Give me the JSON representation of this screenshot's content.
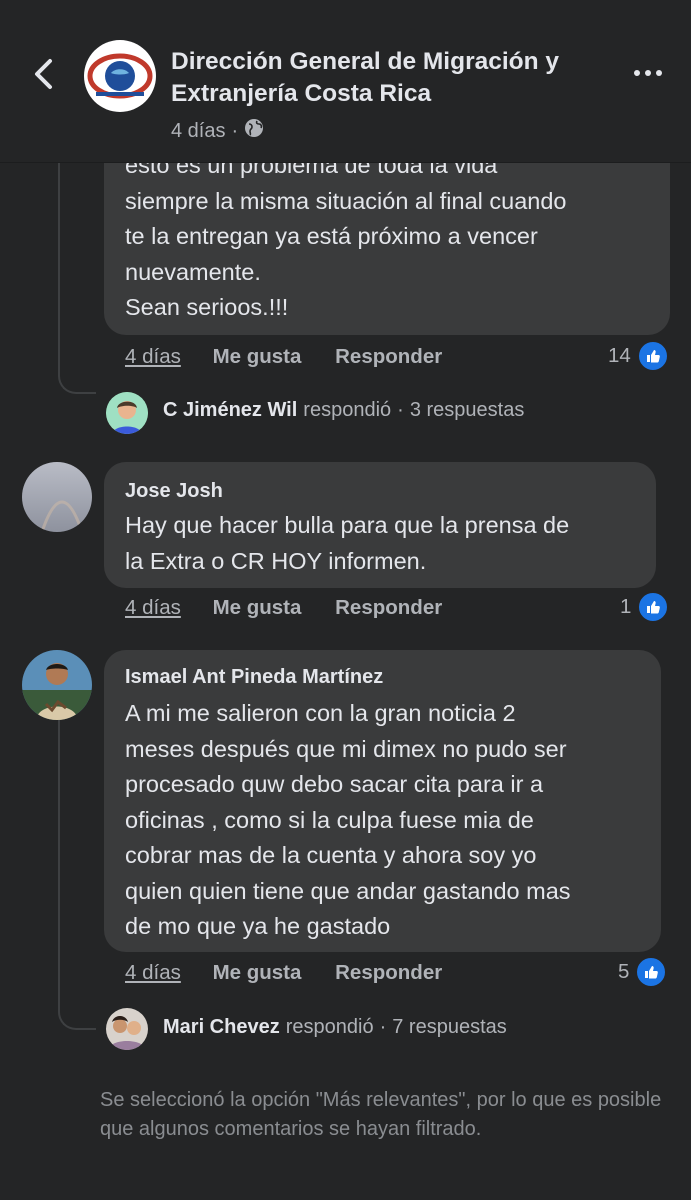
{
  "header": {
    "page_name": "Dirección General de Migración y Extranjería Costa Rica",
    "time": "4 días",
    "separator": "·",
    "audience_icon": "globe-icon",
    "back_icon": "chevron-left-icon",
    "more_icon": "more-horizontal-icon"
  },
  "comments": [
    {
      "text": "esto es un problema de toda la vida\nsiempre la misma situación al final cuando\nte la entregan ya está próximo a vencer\nnuevamente.\nSean serioos.!!!",
      "time": "4 días",
      "like_label": "Me gusta",
      "reply_label": "Responder",
      "likes": "14"
    },
    {
      "author": "Jose Josh",
      "text": "Hay que hacer bulla para que la prensa de\nla Extra o CR HOY informen.",
      "time": "4 días",
      "like_label": "Me gusta",
      "reply_label": "Responder",
      "likes": "1"
    },
    {
      "author": "Ismael Ant Pineda Martínez",
      "text": "A mi me salieron con la gran noticia 2\nmeses después que mi dimex no pudo ser\nprocesado quw debo sacar cita para ir a\noficinas , como si la culpa fuese mia de\ncobrar mas de la cuenta y ahora soy yo\nquien quien tiene que andar gastando mas\nde mo que ya he gastado",
      "time": "4 días",
      "like_label": "Me gusta",
      "reply_label": "Responder",
      "likes": "5"
    }
  ],
  "replies": [
    {
      "name": "C Jiménez Wil",
      "verb": "respondió",
      "sep": "·",
      "count": "3 respuestas"
    },
    {
      "name": "Mari Chevez",
      "verb": "respondió",
      "sep": "·",
      "count": "7 respuestas"
    }
  ],
  "footer_note": "Se seleccionó la opción \"Más relevantes\", por lo que es posible que algunos comentarios se hayan filtrado.",
  "colors": {
    "background": "#242526",
    "bubble": "#3a3b3c",
    "like_blue": "#1b74e4",
    "secondary_text": "#b0b3b8"
  }
}
